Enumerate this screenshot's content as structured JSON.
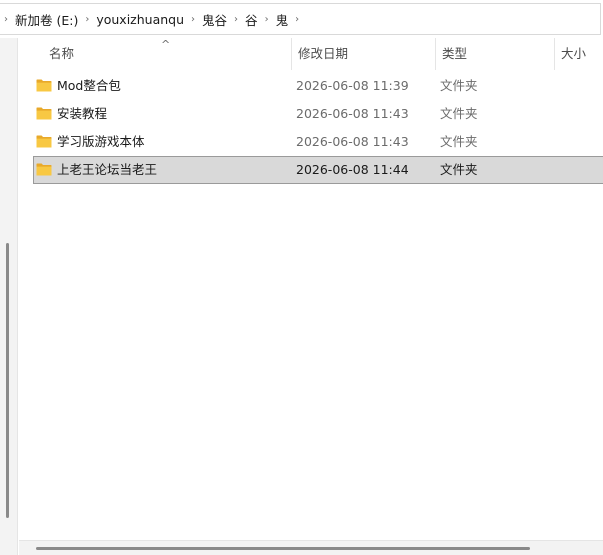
{
  "address_bar": {
    "crumbs": [
      "新加卷 (E:)",
      "youxizhuanqu",
      "鬼谷",
      "谷",
      "鬼"
    ]
  },
  "columns": {
    "name": "名称",
    "date_modified": "修改日期",
    "type": "类型",
    "size": "大小"
  },
  "files": [
    {
      "name": "Mod整合包",
      "date": "2026-06-08 11:39",
      "type": "文件夹",
      "selected": false
    },
    {
      "name": "安装教程",
      "date": "2026-06-08 11:43",
      "type": "文件夹",
      "selected": false
    },
    {
      "name": "学习版游戏本体",
      "date": "2026-06-08 11:43",
      "type": "文件夹",
      "selected": false
    },
    {
      "name": "上老王论坛当老王",
      "date": "2026-06-08 11:44",
      "type": "文件夹",
      "selected": true
    }
  ],
  "icons": {
    "folder": "folder-icon",
    "breadcrumb_separator": "chevron-right-icon",
    "sort_indicator": "sort-ascending-icon"
  },
  "colors": {
    "folder_yellow": "#f8c843",
    "selection_bg": "#d9d9d9",
    "selection_border": "#9a9a9a"
  }
}
